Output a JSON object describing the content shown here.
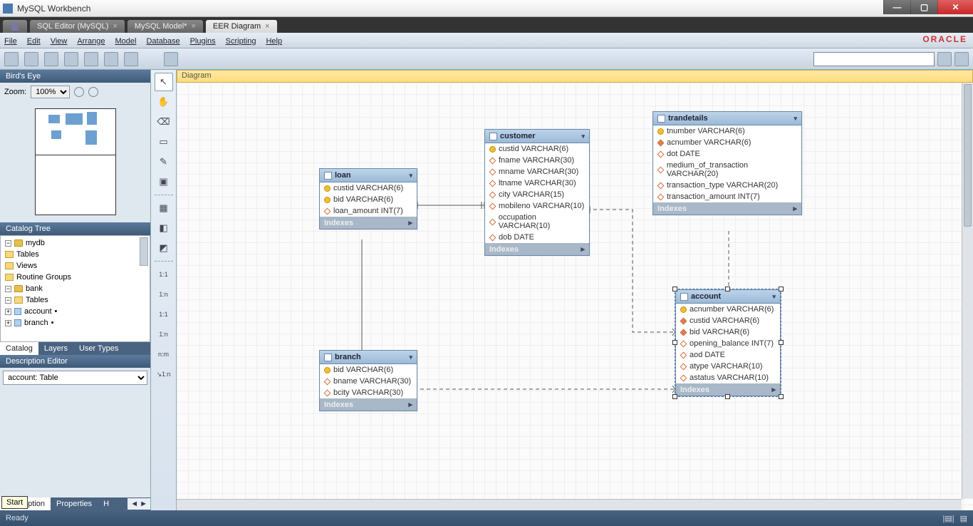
{
  "window": {
    "title": "MySQL Workbench"
  },
  "window_tabs": [
    {
      "label": "",
      "home": true
    },
    {
      "label": "SQL Editor (MySQL)"
    },
    {
      "label": "MySQL Model*"
    },
    {
      "label": "EER Diagram",
      "active": true
    }
  ],
  "menu": [
    "File",
    "Edit",
    "View",
    "Arrange",
    "Model",
    "Database",
    "Plugins",
    "Scripting",
    "Help"
  ],
  "oracle": "ORACLE",
  "birdseye": {
    "title": "Bird's Eye",
    "zoom_label": "Zoom:",
    "zoom_value": "100%"
  },
  "catalog": {
    "title": "Catalog Tree",
    "mydb": "mydb",
    "bank": "bank",
    "folders": {
      "tables": "Tables",
      "views": "Views",
      "routines": "Routine Groups"
    },
    "bank_tables": [
      "account",
      "branch"
    ],
    "tabs": [
      "Catalog",
      "Layers",
      "User Types"
    ]
  },
  "desc_editor": {
    "title": "Description Editor",
    "value": "account: Table"
  },
  "bottom_tabs": [
    "Description",
    "Properties",
    "H"
  ],
  "canvas": {
    "title": "Diagram"
  },
  "entities": {
    "loan": {
      "name": "loan",
      "cols": [
        {
          "k": true,
          "t": "custid VARCHAR(6)"
        },
        {
          "k": true,
          "t": "bid VARCHAR(6)"
        },
        {
          "d": true,
          "t": "loan_amount INT(7)"
        }
      ],
      "foot": "Indexes"
    },
    "branch": {
      "name": "branch",
      "cols": [
        {
          "k": true,
          "t": "bid VARCHAR(6)"
        },
        {
          "d": true,
          "t": "bname VARCHAR(30)"
        },
        {
          "d": true,
          "t": "bcity VARCHAR(30)"
        }
      ],
      "foot": "Indexes"
    },
    "customer": {
      "name": "customer",
      "cols": [
        {
          "k": true,
          "t": "custid VARCHAR(6)"
        },
        {
          "d": true,
          "t": "fname VARCHAR(30)"
        },
        {
          "d": true,
          "t": "mname VARCHAR(30)"
        },
        {
          "d": true,
          "t": "ltname VARCHAR(30)"
        },
        {
          "d": true,
          "t": "city VARCHAR(15)"
        },
        {
          "d": true,
          "t": "mobileno VARCHAR(10)"
        },
        {
          "d": true,
          "t": "occupation VARCHAR(10)"
        },
        {
          "d": true,
          "t": "dob DATE"
        }
      ],
      "foot": "Indexes"
    },
    "trandetails": {
      "name": "trandetails",
      "cols": [
        {
          "k": true,
          "t": "tnumber VARCHAR(6)"
        },
        {
          "df": true,
          "t": "acnumber VARCHAR(6)"
        },
        {
          "d": true,
          "t": "dot DATE"
        },
        {
          "d": true,
          "t": "medium_of_transaction VARCHAR(20)"
        },
        {
          "d": true,
          "t": "transaction_type VARCHAR(20)"
        },
        {
          "d": true,
          "t": "transaction_amount INT(7)"
        }
      ],
      "foot": "Indexes"
    },
    "account": {
      "name": "account",
      "cols": [
        {
          "k": true,
          "t": "acnumber VARCHAR(6)"
        },
        {
          "df": true,
          "t": "custid VARCHAR(6)"
        },
        {
          "df": true,
          "t": "bid VARCHAR(6)"
        },
        {
          "d": true,
          "t": "opening_balance INT(7)"
        },
        {
          "d": true,
          "t": "aod DATE"
        },
        {
          "d": true,
          "t": "atype VARCHAR(10)"
        },
        {
          "d": true,
          "t": "astatus VARCHAR(10)"
        }
      ],
      "foot": "Indexes"
    }
  },
  "status": {
    "ready": "Ready",
    "tip": "Start"
  },
  "search": {
    "placeholder": ""
  }
}
